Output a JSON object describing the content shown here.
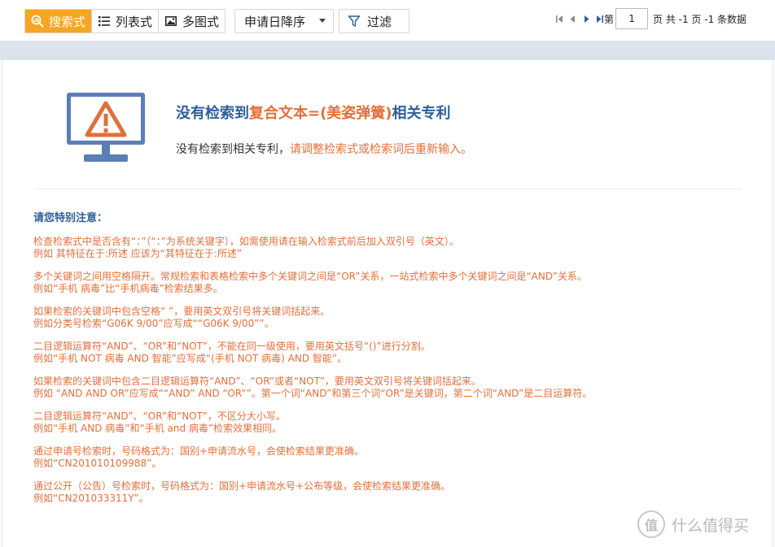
{
  "toolbar": {
    "views": [
      {
        "label": "搜索式",
        "icon": "search-view-icon",
        "active": true
      },
      {
        "label": "列表式",
        "icon": "list-view-icon",
        "active": false
      },
      {
        "label": "多图式",
        "icon": "image-view-icon",
        "active": false
      }
    ],
    "sort_label": "申请日降序",
    "filter_label": "过滤"
  },
  "pager": {
    "page_prefix": "第",
    "current_page": "1",
    "summary": "页 共 -1 页 -1 条数据"
  },
  "result": {
    "title_prefix": "没有检索到",
    "title_query": "复合文本=(美姿弹簧)",
    "title_suffix": "相关专利",
    "subtitle_prefix": "没有检索到相关专利，",
    "subtitle_hint": "请调整检索式或检索词后重新输入。"
  },
  "notes": {
    "title": "请您特别注意：",
    "items": [
      [
        "检查检索式中是否含有“：”（“：”为系统关键字），如需使用请在输入检索式前后加入双引号（英文）。",
        "例如 其特征在于:所述 应该为“其特征在于:所述”"
      ],
      [
        "多个关键词之间用空格隔开。常规检索和表格检索中多个关键词之间是“OR”关系，一站式检索中多个关键词之间是“AND”关系。",
        "例如“手机 病毒”比“手机病毒”检索结果多。"
      ],
      [
        "如果检索的关键词中包含空格“ ”，要用英文双引号将关键词括起来。",
        "例如分类号检索“G06K 9/00”应写成““G06K 9/00””。"
      ],
      [
        "二目逻辑运算符“AND”、“OR”和“NOT”，不能在同一级使用，要用英文括号“()”进行分割。",
        "例如“手机 NOT 病毒 AND 智能”应写成“(手机 NOT 病毒) AND 智能”。"
      ],
      [
        "如果检索的关键词中包含二目逻辑运算符“AND”、“OR”或者“NOT”，要用英文双引号将关键词括起来。",
        "例如 “AND AND OR”应写成““AND” AND “OR””。第一个词“AND”和第三个词“OR”是关键词，第二个词“AND”是二目运算符。"
      ],
      [
        "二目逻辑运算符“AND”、“OR”和“NOT”，不区分大小写。",
        "例如“手机 AND 病毒”和“手机 and 病毒”检索效果相同。"
      ],
      [
        "通过申请号检索时，号码格式为：国别+申请流水号，会使检索结果更准确。",
        "例如“CN201010109988”。"
      ],
      [
        "通过公开（公告）号检索时，号码格式为：国别+申请流水号+公布等级，会使检索结果更准确。",
        "例如“CN201033311Y”。"
      ]
    ]
  },
  "watermark": {
    "icon_text": "值",
    "text": "什么值得买"
  },
  "colors": {
    "accent": "#f5a623",
    "title_blue": "#2e5f9a",
    "note_orange": "#e0703c",
    "band": "#dde3ed"
  }
}
